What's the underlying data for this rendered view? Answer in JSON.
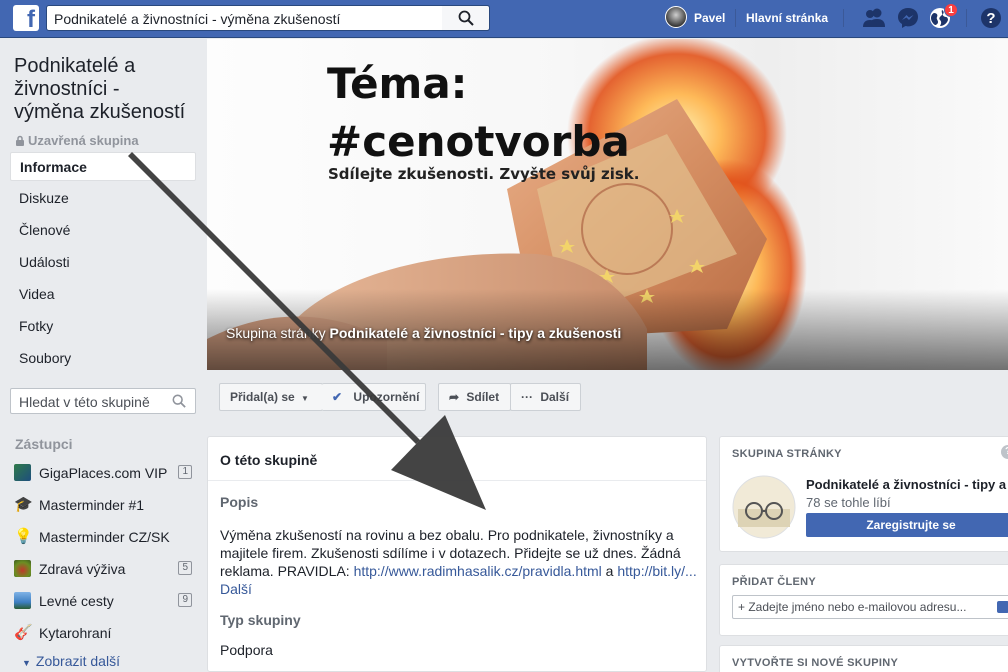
{
  "topbar": {
    "logo": "f",
    "search_value": "Podnikatelé a živnostníci - výměna zkušeností",
    "user_name": "Pavel",
    "home_label": "Hlavní stránka",
    "notification_count": "1"
  },
  "group": {
    "name": "Podnikatelé a živnostníci - výměna zkušeností",
    "privacy": "Uzavřená skupina"
  },
  "nav": {
    "items": [
      "Informace",
      "Diskuze",
      "Členové",
      "Události",
      "Videa",
      "Fotky",
      "Soubory"
    ],
    "active": "Informace"
  },
  "left_search": {
    "placeholder": "Hledat v této skupině"
  },
  "shortcuts": {
    "heading": "Zástupci",
    "items": [
      {
        "label": "GigaPlaces.com VIP",
        "count": "1"
      },
      {
        "label": "Masterminder #1",
        "count": ""
      },
      {
        "label": "Masterminder CZ/SK",
        "count": ""
      },
      {
        "label": "Zdravá výživa",
        "count": "5"
      },
      {
        "label": "Levné cesty",
        "count": "9"
      },
      {
        "label": "Kytarohraní",
        "count": ""
      }
    ],
    "more": "Zobrazit další"
  },
  "cover": {
    "title_line1": "Téma:",
    "title_line2": "#cenotvorba",
    "subtitle": "Sdílejte zkušenosti. Zvyšte svůj zisk.",
    "caption_prefix": "Skupina stránky",
    "caption_page": "Podnikatelé a živnostníci - tipy a zkušenosti"
  },
  "actions": {
    "joined": "Přidal(a) se",
    "notifications": "Upozornění",
    "share": "Sdílet",
    "more": "Další"
  },
  "about": {
    "title": "O této skupině",
    "description_heading": "Popis",
    "description": "Výměna zkušeností na rovinu a bez obalu. Pro podnikatele, živnostníky a majitele firem.  Zkušenosti sdílíme i v dotazech. Přidejte se už dnes. Žádná reklama. PRAVIDLA: ",
    "link1": "http://www.radimhasalik.cz/pravidla.html",
    "link_joiner": " a ",
    "link2": "http://bit.ly/...",
    "more_link": " Další",
    "type_heading": "Typ skupiny",
    "type_value": "Podpora"
  },
  "page_card": {
    "title": "SKUPINA STRÁNKY",
    "page_name": "Podnikatelé a živnostníci - tipy a",
    "likes": "78 se tohle líbí",
    "button": "Zaregistrujte se"
  },
  "add_members": {
    "title": "PŘIDAT ČLENY",
    "placeholder": "+ Zadejte jméno nebo e-mailovou adresu..."
  },
  "create_group": {
    "title": "VYTVOŘTE SI NOVÉ SKUPINY"
  },
  "colors": {
    "brand": "#4267b2",
    "link": "#365899",
    "annotation_arrow": "#3a3a3a"
  }
}
